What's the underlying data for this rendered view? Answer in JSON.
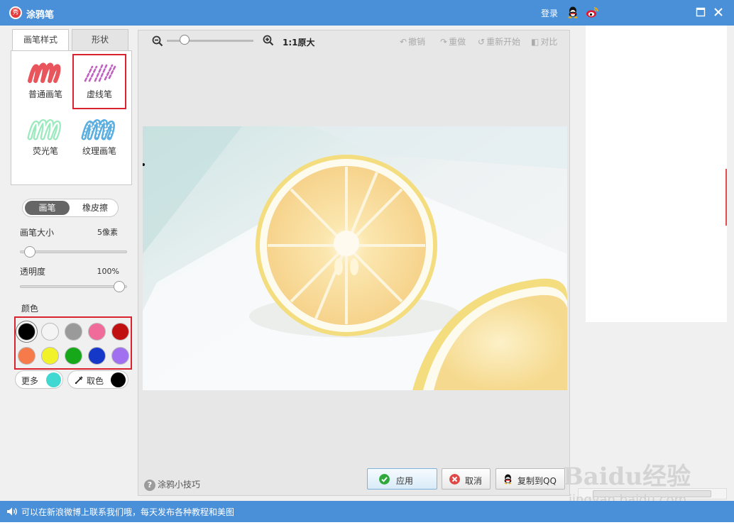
{
  "window": {
    "title": "涂鸦笔",
    "login_label": "登录"
  },
  "left": {
    "tabs": [
      {
        "label": "画笔样式",
        "active": true
      },
      {
        "label": "形状",
        "active": false
      }
    ],
    "brushes": [
      {
        "label": "普通画笔",
        "color": "#e8555c"
      },
      {
        "label": "虚线笔",
        "color": "#c060c0",
        "selected": true
      },
      {
        "label": "荧光笔",
        "color": "#8ee8b0"
      },
      {
        "label": "纹理画笔",
        "color": "#5aaee0"
      }
    ],
    "mode": {
      "pen_label": "画笔",
      "eraser_label": "橡皮擦",
      "active": "pen"
    },
    "brush_size": {
      "label": "画笔大小",
      "value": "5像素",
      "level": 0.05
    },
    "opacity": {
      "label": "透明度",
      "value": "100%",
      "level": 1.0
    },
    "color_section": {
      "label": "颜色",
      "swatches": [
        "#000000",
        "#f4f4f4",
        "#9a9a9a",
        "#f06a9a",
        "#c01010",
        "#f77a4a",
        "#f2f22a",
        "#17a81a",
        "#1538c8",
        "#a070f0"
      ],
      "selected": 0
    },
    "more": {
      "label": "更多",
      "color": "#40d8d0"
    },
    "picker": {
      "label": "取色",
      "color": "#000000"
    }
  },
  "canvas": {
    "orig_size_label": "1:1原大",
    "undo_label": "撤销",
    "redo_label": "重做",
    "restart_label": "重新开始",
    "compare_label": "对比",
    "zoom_level": 0.2,
    "tips_label": "涂鸦小技巧",
    "apply_label": "应用",
    "cancel_label": "取消",
    "copy_label": "复制到QQ"
  },
  "status": {
    "text": "可以在新浪微博上联系我们哦，每天发布各种教程和美图"
  },
  "watermark": {
    "line1": "Baidu经验",
    "line2": "jingyan.baidu.com"
  }
}
